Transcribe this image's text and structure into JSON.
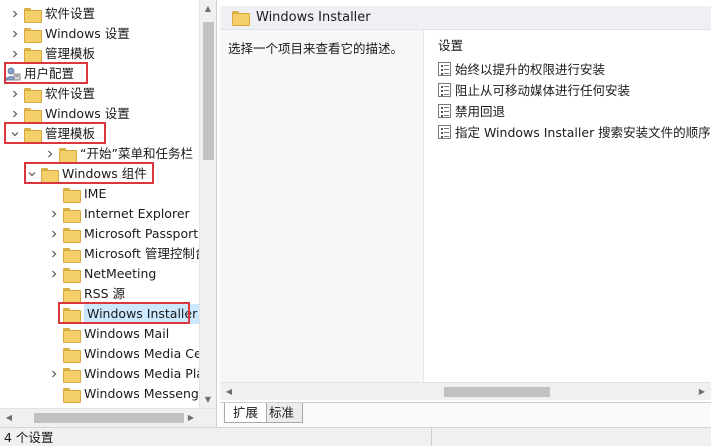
{
  "tree": {
    "items": [
      {
        "label": "软件设置",
        "chevron": "right",
        "icon": "folder"
      },
      {
        "label": "Windows 设置",
        "chevron": "right",
        "icon": "folder"
      },
      {
        "label": "管理模板",
        "chevron": "right",
        "icon": "folder"
      },
      {
        "label": "用户配置",
        "chevron": "none",
        "icon": "user",
        "highlighted": true
      },
      {
        "label": "软件设置",
        "chevron": "right",
        "icon": "folder"
      },
      {
        "label": "Windows 设置",
        "chevron": "right",
        "icon": "folder"
      },
      {
        "label": "管理模板",
        "chevron": "down",
        "icon": "folder",
        "highlighted": true
      },
      {
        "label": "“开始”菜单和任务栏",
        "chevron": "right",
        "icon": "folder"
      },
      {
        "label": "Windows 组件",
        "chevron": "down",
        "icon": "folder",
        "highlighted": true
      },
      {
        "label": "IME",
        "chevron": "none",
        "icon": "folder"
      },
      {
        "label": "Internet Explorer",
        "chevron": "right",
        "icon": "folder"
      },
      {
        "label": "Microsoft Passport",
        "chevron": "right",
        "icon": "folder"
      },
      {
        "label": "Microsoft 管理控制台",
        "chevron": "right",
        "icon": "folder"
      },
      {
        "label": "NetMeeting",
        "chevron": "right",
        "icon": "folder"
      },
      {
        "label": "RSS 源",
        "chevron": "none",
        "icon": "folder"
      },
      {
        "label": "Windows Installer",
        "chevron": "none",
        "icon": "folder",
        "selected": true,
        "highlighted": true
      },
      {
        "label": "Windows Mail",
        "chevron": "none",
        "icon": "folder"
      },
      {
        "label": "Windows Media Center",
        "chevron": "none",
        "icon": "folder"
      },
      {
        "label": "Windows Media Player",
        "chevron": "right",
        "icon": "folder"
      },
      {
        "label": "Windows Messenger",
        "chevron": "none",
        "icon": "folder"
      }
    ]
  },
  "detail": {
    "title": "Windows Installer",
    "description": "选择一个项目来查看它的描述。",
    "settings_heading": "设置",
    "settings": [
      "始终以提升的权限进行安装",
      "阻止从可移动媒体进行任何安装",
      "禁用回退",
      "指定 Windows Installer 搜索安装文件的顺序"
    ]
  },
  "tabs": {
    "expanded": "扩展",
    "standard": "标准"
  },
  "status": {
    "text": "4 个设置"
  },
  "colors": {
    "highlight_box": "#d9363e",
    "selection": "#cce8ff",
    "folder": "#f4cf6a"
  }
}
